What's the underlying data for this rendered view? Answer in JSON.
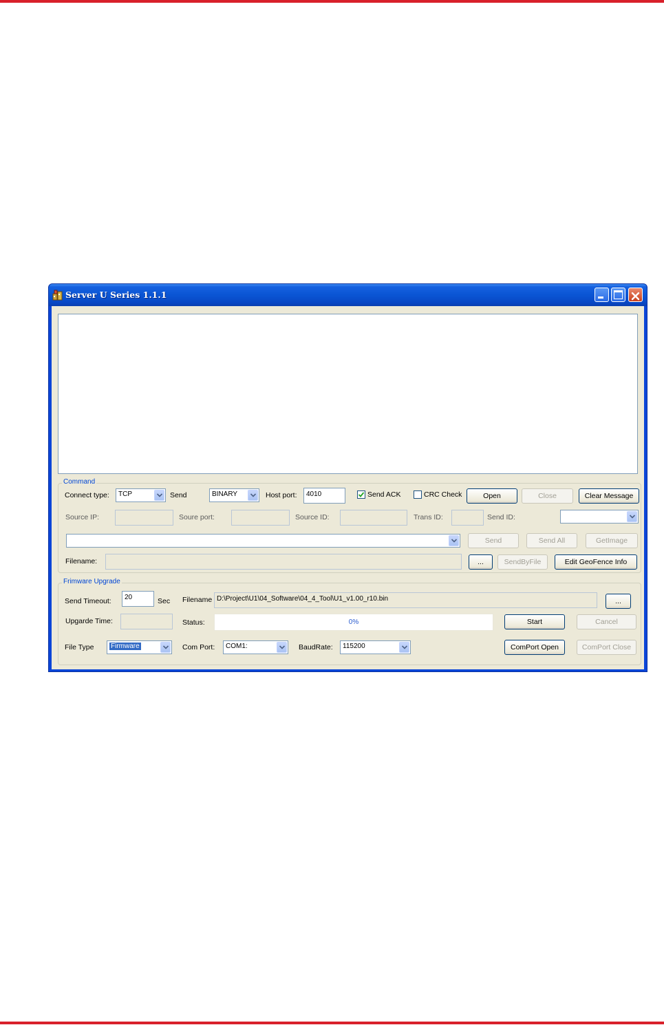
{
  "window": {
    "title": "Server U Series 1.1.1"
  },
  "command": {
    "group_label": "Command",
    "connect_type_label": "Connect type:",
    "connect_type_value": "TCP",
    "send_label": "Send",
    "send_format_value": "BINARY",
    "host_port_label": "Host port:",
    "host_port_value": "4010",
    "send_ack_label": "Send ACK",
    "send_ack_checked": true,
    "crc_check_label": "CRC Check",
    "crc_check_checked": false,
    "open_button": "Open",
    "close_button": "Close",
    "clear_message_button": "Clear Message",
    "source_ip_label": "Source IP:",
    "source_port_label": "Soure port:",
    "source_id_label": "Source ID:",
    "trans_id_label": "Trans ID:",
    "send_id_label": "Send ID:",
    "send_button": "Send",
    "send_all_button": "Send All",
    "getimage_button": "GetImage",
    "filename_label": "Filename:",
    "browse_button": "...",
    "sendbyfile_button": "SendByFile",
    "edit_geofence_button": "Edit GeoFence Info"
  },
  "firmware": {
    "group_label": "Frimware Upgrade",
    "send_timeout_label": "Send Timeout:",
    "send_timeout_value": "20",
    "sec_label": "Sec",
    "filename_label": "Filename",
    "filename_value": "D:\\Project\\U1\\04_Software\\04_4_Tool\\U1_v1.00_r10.bin",
    "browse_button": "...",
    "upgrade_time_label": "Upgarde Time:",
    "status_label": "Status:",
    "progress_text": "0%",
    "progress_fraction": 0,
    "start_button": "Start",
    "cancel_button": "Cancel",
    "file_type_label": "File Type",
    "file_type_value": "Firmware",
    "com_port_label": "Com Port:",
    "com_port_value": "COM1:",
    "baudrate_label": "BaudRate:",
    "baudrate_value": "115200",
    "comport_open_button": "ComPort Open",
    "comport_close_button": "ComPort Close"
  },
  "colors": {
    "page_rule": "#d8202a",
    "titlebar": "#0a55d4",
    "window_face": "#ece9d8",
    "group_label": "#0046d5"
  },
  "icons": {
    "app": "app-icon",
    "minimize": "minimize-icon",
    "maximize": "maximize-icon",
    "close": "close-icon",
    "dropdown": "chevron-down-icon",
    "checkmark": "checkmark-icon"
  }
}
